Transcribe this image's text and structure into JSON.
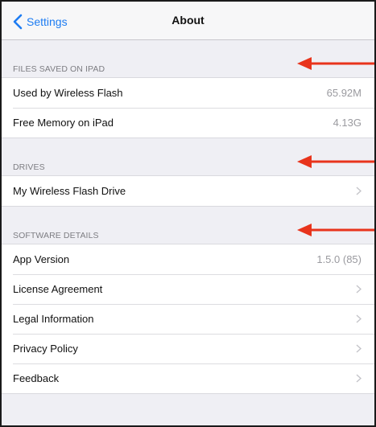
{
  "navbar": {
    "back_label": "Settings",
    "title": "About"
  },
  "sections": {
    "files": {
      "header": "FILES SAVED ON IPAD",
      "used_label": "Used by Wireless Flash",
      "used_value": "65.92M",
      "free_label": "Free Memory on iPad",
      "free_value": "4.13G"
    },
    "drives": {
      "header": "DRIVES",
      "drive_label": "My Wireless Flash Drive"
    },
    "software": {
      "header": "SOFTWARE DETAILS",
      "version_label": "App Version",
      "version_value": "1.5.0 (85)",
      "license_label": "License Agreement",
      "legal_label": "Legal Information",
      "privacy_label": "Privacy Policy",
      "feedback_label": "Feedback"
    }
  },
  "colors": {
    "accent": "#1d7cf2",
    "annotation_arrow": "#e8341c"
  },
  "icons": {
    "back": "chevron-left-icon",
    "disclosure": "chevron-right-icon",
    "annotation": "arrow-left-icon"
  }
}
